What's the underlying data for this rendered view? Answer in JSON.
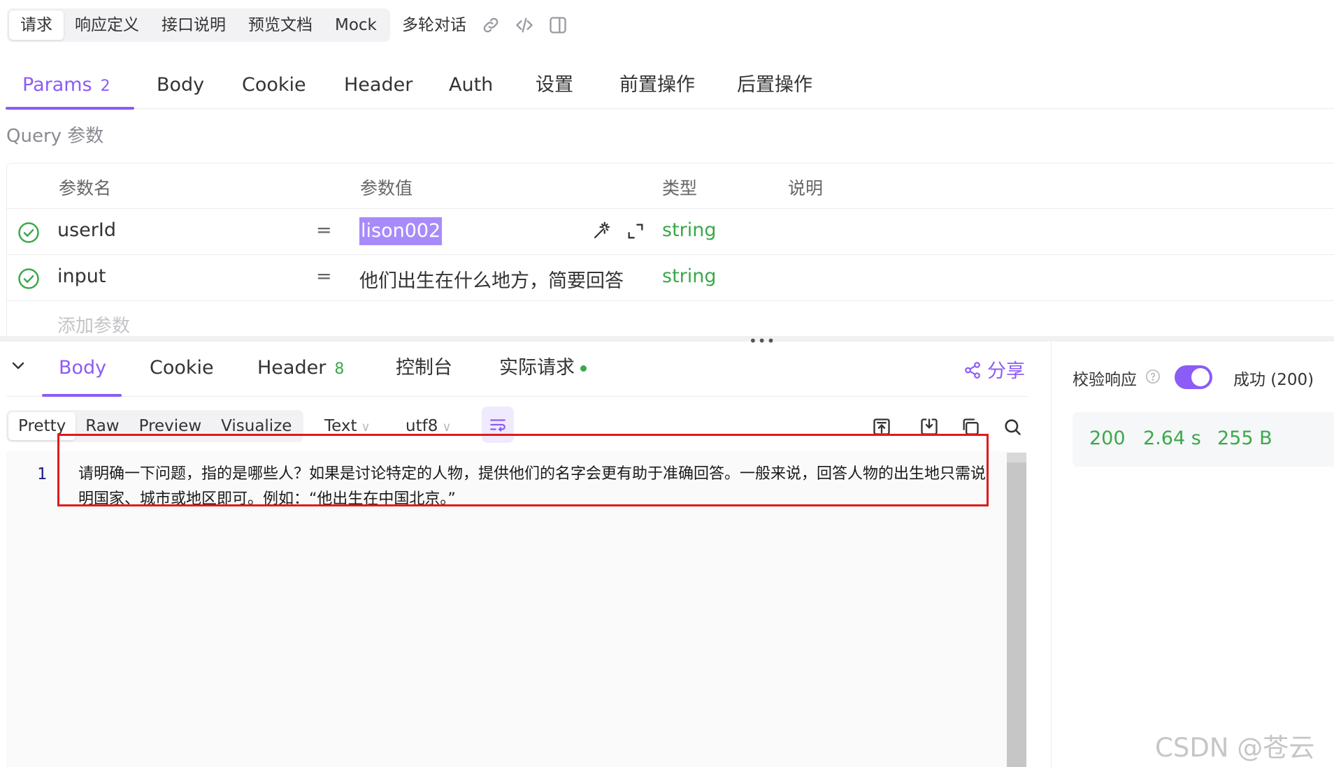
{
  "top_tabs": [
    {
      "label": "请求"
    },
    {
      "label": "响应定义"
    },
    {
      "label": "接口说明"
    },
    {
      "label": "预览文档"
    },
    {
      "label": "Mock"
    }
  ],
  "top_extra": {
    "multi_turn": "多轮对话",
    "icons": [
      "link-icon",
      "code-icon",
      "split-panel-icon"
    ]
  },
  "request_tabs": [
    {
      "label": "Params",
      "count": "2"
    },
    {
      "label": "Body"
    },
    {
      "label": "Cookie"
    },
    {
      "label": "Header"
    },
    {
      "label": "Auth"
    },
    {
      "label": "设置"
    },
    {
      "label": "前置操作"
    },
    {
      "label": "后置操作"
    }
  ],
  "query": {
    "title": "Query 参数",
    "headers": [
      "参数名",
      "参数值",
      "类型",
      "说明"
    ],
    "rows": [
      {
        "name": "userId",
        "eq": "=",
        "value": "lison002",
        "type": "string"
      },
      {
        "name": "input",
        "eq": "=",
        "value": "他们出生在什么地方，简要回答",
        "type": "string"
      }
    ],
    "add_placeholder": "添加参数"
  },
  "response": {
    "tabs": [
      {
        "label": "Body"
      },
      {
        "label": "Cookie"
      },
      {
        "label": "Header",
        "count": "8"
      },
      {
        "label": "控制台"
      },
      {
        "label": "实际请求"
      }
    ],
    "share_label": "分享",
    "formats": [
      "Pretty",
      "Raw",
      "Preview",
      "Visualize"
    ],
    "content_type": "Text",
    "encoding": "utf8",
    "line_number": "1",
    "body_text": "请明确一下问题，指的是哪些人？如果是讨论特定的人物，提供他们的名字会更有助于准确回答。一般来说，回答人物的出生地只需说明国家、城市或地区即可。例如：“他出生在中国北京。”",
    "verify_label": "校验响应",
    "verify_enabled": true,
    "status_label": "成功 (200)",
    "stats": {
      "status_code": "200",
      "time": "2.64 s",
      "size": "255 B"
    }
  },
  "watermark": "CSDN @苍云烟",
  "colors": {
    "accent": "#8b5cf6",
    "success": "#3aa94a",
    "highlight_box": "#e01a1a"
  }
}
